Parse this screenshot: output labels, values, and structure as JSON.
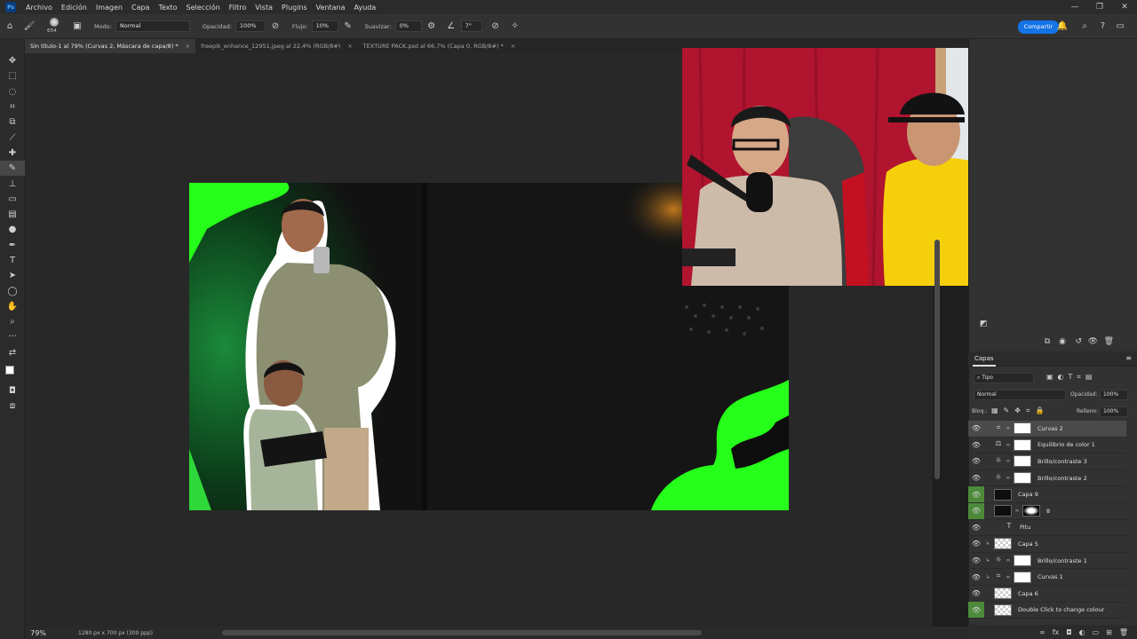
{
  "app": {
    "logo": "Ps"
  },
  "menu": [
    "Archivo",
    "Edición",
    "Imagen",
    "Capa",
    "Texto",
    "Selección",
    "Filtro",
    "Vista",
    "Plugins",
    "Ventana",
    "Ayuda"
  ],
  "window_controls": [
    "—",
    "❐",
    "✕"
  ],
  "options": {
    "brush_size": "654",
    "mode_label": "Modo:",
    "mode_value": "Normal",
    "opacity_label": "Opacidad:",
    "opacity_value": "100%",
    "flow_label": "Flujo:",
    "flow_value": "10%",
    "smooth_label": "Suavizar:",
    "smooth_value": "0%",
    "angle_value": "7°",
    "share_label": "Compartir"
  },
  "tabs": [
    {
      "label": "Sin título-1 al 79% (Curvas 2, Máscara de capa/8) *",
      "active": true
    },
    {
      "label": "freepik_enhance_12951.jpeg al 22,4% (RGB/8#)",
      "active": false
    },
    {
      "label": "TEXTURE PACK.psd al 66,7% (Capa 0, RGB/8#) *",
      "active": false
    }
  ],
  "status": {
    "zoom": "79%",
    "dims": "1280 px x 700 px (300 ppp)"
  },
  "layers_panel": {
    "tab": "Capas",
    "filter_value": "Tipo",
    "blend_mode": "Normal",
    "opacity_label": "Opacidad:",
    "opacity_value": "100%",
    "lock_label": "Bloq.:",
    "fill_label": "Relleno:",
    "fill_value": "100%",
    "layers": [
      {
        "name": "Curvas 2",
        "kind": "adjustment",
        "icon": "curves-icon",
        "thumb": "white",
        "selected": true,
        "green": false,
        "clipped": false
      },
      {
        "name": "Equilibrio de color 1",
        "kind": "adjustment",
        "icon": "color-balance-icon",
        "thumb": "white",
        "selected": false,
        "green": false,
        "clipped": false
      },
      {
        "name": "Brillo/contraste 3",
        "kind": "adjustment",
        "icon": "brightness-icon",
        "thumb": "white",
        "selected": false,
        "green": false,
        "clipped": false
      },
      {
        "name": "Brillo/contraste 2",
        "kind": "adjustment",
        "icon": "brightness-icon",
        "thumb": "white",
        "selected": false,
        "green": false,
        "clipped": false
      },
      {
        "name": "Capa 9",
        "kind": "pixel",
        "thumb": "black",
        "selected": false,
        "green": true,
        "clipped": false
      },
      {
        "name": "8",
        "kind": "pixel-mask",
        "thumb": "black",
        "selected": false,
        "green": true,
        "clipped": false
      },
      {
        "name": "Pitu",
        "kind": "text",
        "selected": false,
        "green": false,
        "clipped": false
      },
      {
        "name": "Capa 5",
        "kind": "pixel",
        "thumb": "checker",
        "selected": false,
        "green": false,
        "clipped": true
      },
      {
        "name": "Brillo/contraste 1",
        "kind": "adjustment",
        "icon": "brightness-icon",
        "thumb": "white",
        "selected": false,
        "green": false,
        "clipped": true
      },
      {
        "name": "Curvas 1",
        "kind": "adjustment",
        "icon": "curves-icon",
        "thumb": "white",
        "selected": false,
        "green": false,
        "clipped": true
      },
      {
        "name": "Capa 6",
        "kind": "pixel",
        "thumb": "checker",
        "selected": false,
        "green": false,
        "clipped": false
      },
      {
        "name": "Double Click to change colour",
        "kind": "pixel",
        "thumb": "checker",
        "selected": false,
        "green": true,
        "clipped": false
      }
    ]
  },
  "colors": {
    "accent": "#1473e6",
    "neon_green": "#26ff1a",
    "layer_eye_green": "#4c8a3a"
  }
}
